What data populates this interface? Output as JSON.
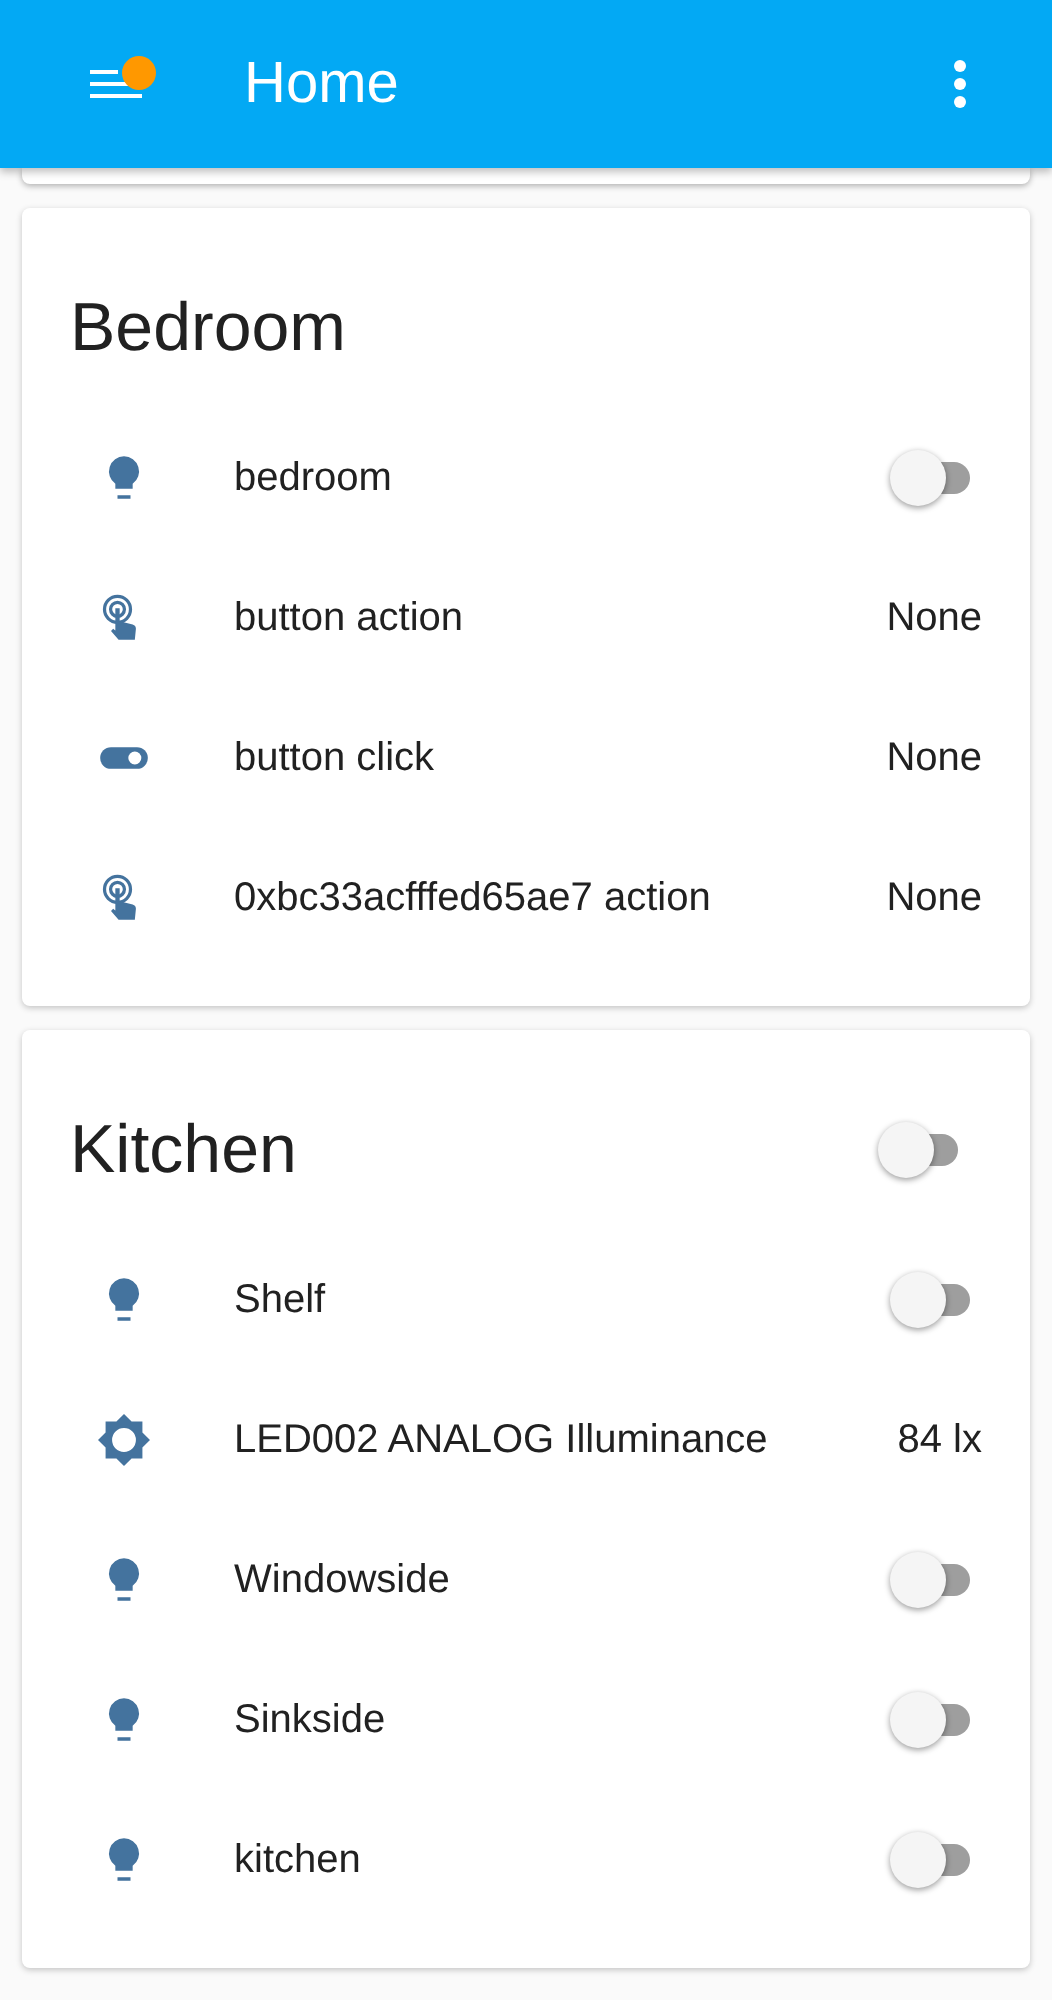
{
  "app_bar": {
    "title": "Home",
    "notification": true
  },
  "cards": [
    {
      "title": "Bedroom",
      "rows": [
        {
          "kind": "light",
          "name": "bedroom",
          "on": false
        },
        {
          "kind": "action",
          "name": "button action",
          "value": "None"
        },
        {
          "kind": "click",
          "name": "button click",
          "value": "None"
        },
        {
          "kind": "action",
          "name": "0xbc33acfffed65ae7 action",
          "value": "None"
        }
      ]
    },
    {
      "title": "Kitchen",
      "header_toggle": {
        "on": false
      },
      "rows": [
        {
          "kind": "light",
          "name": "Shelf",
          "on": false
        },
        {
          "kind": "illuminance",
          "name": "LED002 ANALOG Illuminance",
          "value": "84 lx"
        },
        {
          "kind": "light",
          "name": "Windowside",
          "on": false
        },
        {
          "kind": "light",
          "name": "Sinkside",
          "on": false
        },
        {
          "kind": "light",
          "name": "kitchen",
          "on": false
        }
      ]
    }
  ]
}
